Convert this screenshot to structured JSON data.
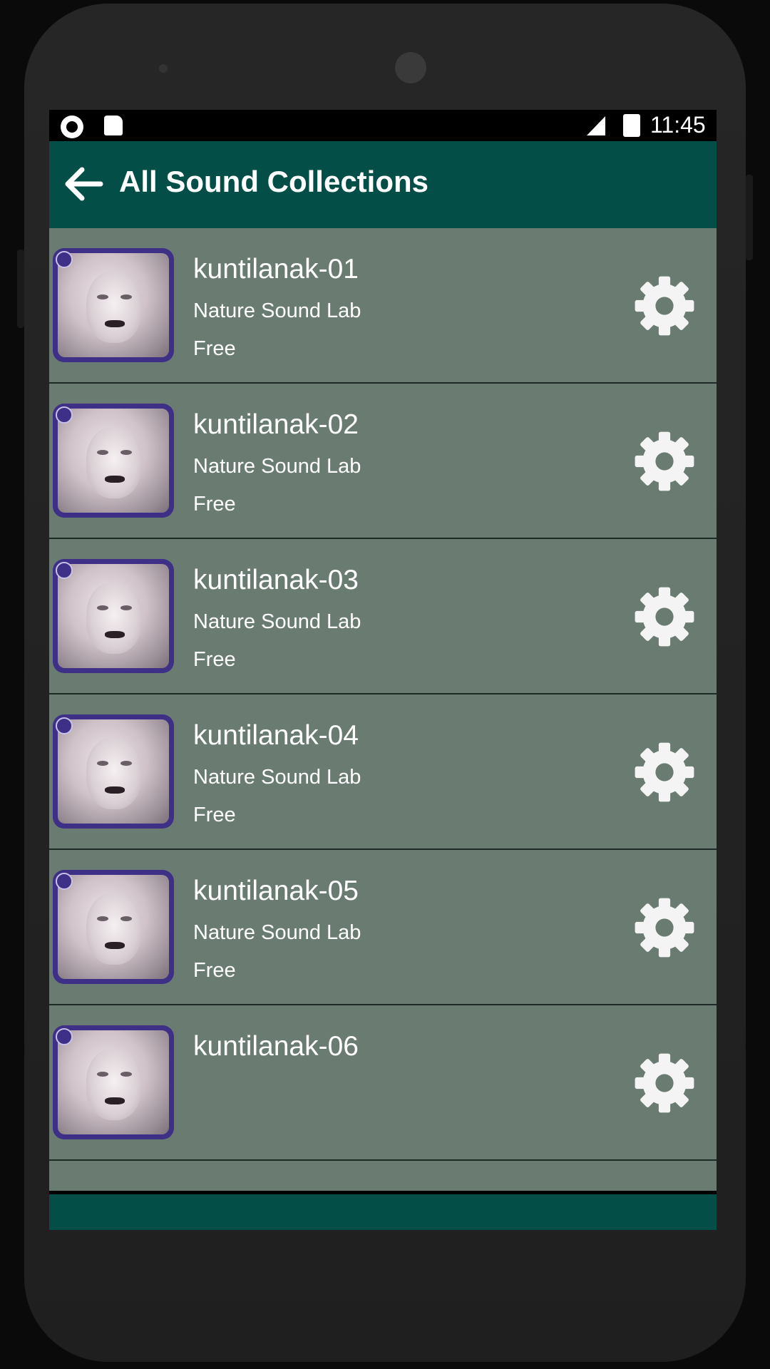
{
  "status_bar": {
    "time": "11:45",
    "icons": [
      "camera-dot-icon",
      "sd-card-icon",
      "no-signal-icon",
      "battery-charging-icon"
    ]
  },
  "app_bar": {
    "back_icon": "arrow-left-icon",
    "title": "All Sound Collections",
    "background": "#034f47"
  },
  "list": {
    "background": "#6a7c72",
    "items": [
      {
        "name": "kuntilanak-01",
        "author": "Nature Sound Lab",
        "price": "Free",
        "action_icon": "gear-icon"
      },
      {
        "name": "kuntilanak-02",
        "author": "Nature Sound Lab",
        "price": "Free",
        "action_icon": "gear-icon"
      },
      {
        "name": "kuntilanak-03",
        "author": "Nature Sound Lab",
        "price": "Free",
        "action_icon": "gear-icon"
      },
      {
        "name": "kuntilanak-04",
        "author": "Nature Sound Lab",
        "price": "Free",
        "action_icon": "gear-icon"
      },
      {
        "name": "kuntilanak-05",
        "author": "Nature Sound Lab",
        "price": "Free",
        "action_icon": "gear-icon"
      },
      {
        "name": "kuntilanak-06",
        "action_icon": "gear-icon"
      }
    ]
  },
  "nav_bar": {
    "icons": [
      "nav-back-icon",
      "nav-home-icon",
      "nav-recent-icon"
    ]
  }
}
